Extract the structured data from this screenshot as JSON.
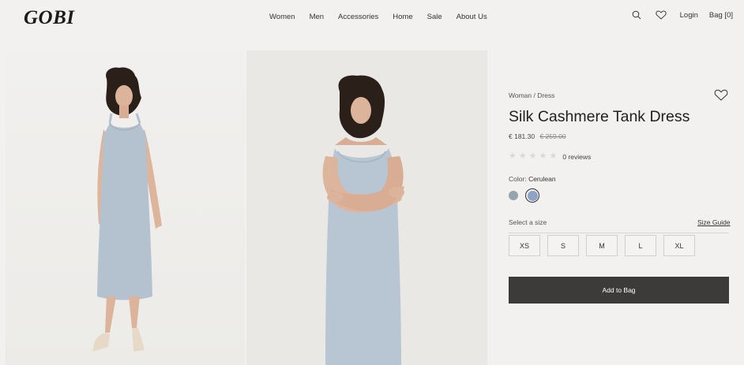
{
  "brand": {
    "logo": "GOBI"
  },
  "nav": [
    "Women",
    "Men",
    "Accessories",
    "Home",
    "Sale",
    "About Us"
  ],
  "header": {
    "login": "Login",
    "bag": "Bag [0]"
  },
  "product": {
    "breadcrumb": "Woman / Dress",
    "title": "Silk Cashmere Tank Dress",
    "price": "€ 181.30",
    "old_price": "€ 259.00",
    "rating_stars": 0,
    "rating_max": 5,
    "reviews": "0 reviews",
    "color_label": "Color:",
    "color_value": "Cerulean",
    "colors": [
      "#94a5ae",
      "#8fa3c6"
    ],
    "size_label": "Select a size",
    "size_guide": "Size Guide",
    "sizes": [
      "XS",
      "S",
      "M",
      "L",
      "XL"
    ],
    "add_to_bag": "Add to Bag"
  },
  "icons": [
    "search-icon",
    "heart-icon",
    "heart-outline-icon",
    "star-icon"
  ]
}
